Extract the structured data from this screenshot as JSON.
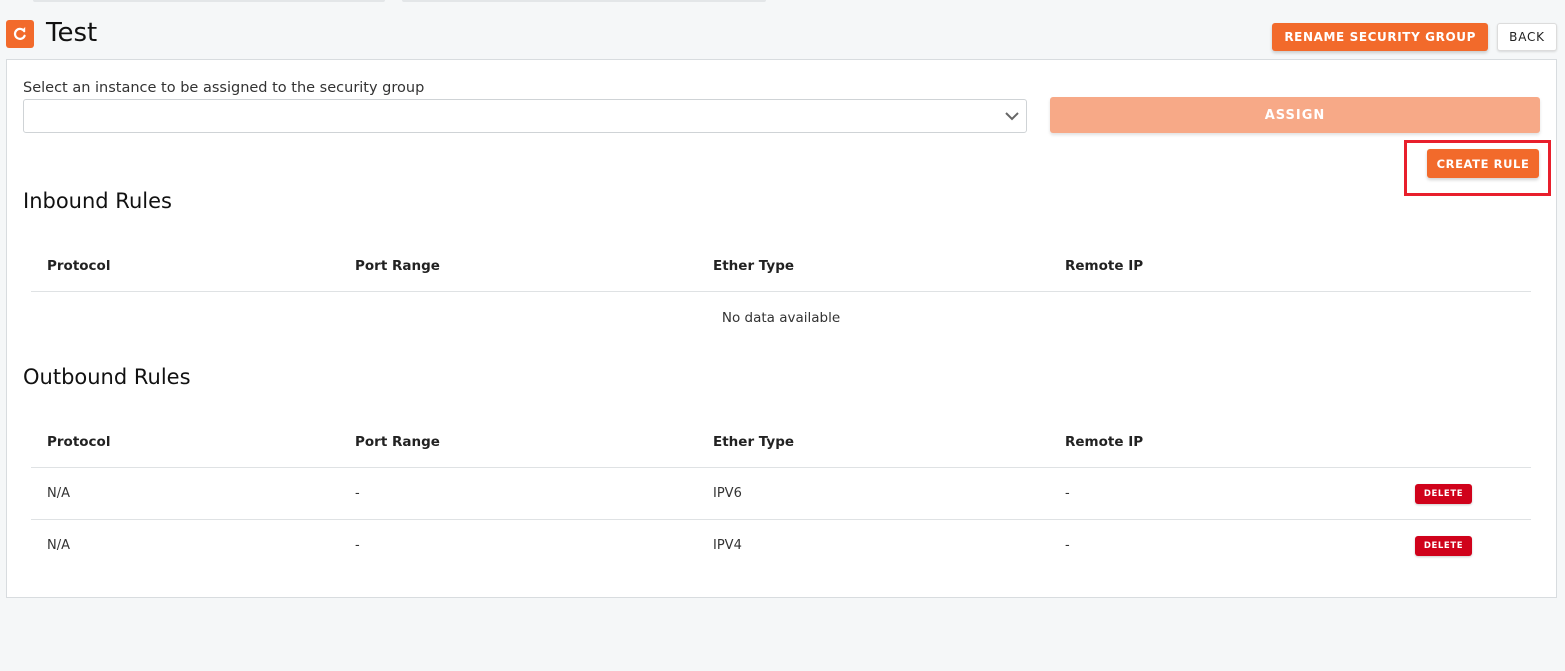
{
  "page": {
    "title": "Test",
    "accent_color": "#f26a2b",
    "refresh_icon": "refresh-icon"
  },
  "header": {
    "rename_label": "RENAME SECURITY GROUP",
    "back_label": "BACK"
  },
  "assign": {
    "select_label": "Select an instance to be assigned to the security group",
    "select_value": "",
    "button_label": "ASSIGN",
    "button_color": "#f7a987"
  },
  "create_rule": {
    "label": "CREATE RULE",
    "highlight_color": "#e81f2c"
  },
  "inbound": {
    "title": "Inbound Rules",
    "columns": [
      "Protocol",
      "Port Range",
      "Ether Type",
      "Remote IP"
    ],
    "empty_text": "No data available",
    "rows": []
  },
  "outbound": {
    "title": "Outbound Rules",
    "columns": [
      "Protocol",
      "Port Range",
      "Ether Type",
      "Remote IP"
    ],
    "delete_label": "DELETE",
    "delete_color": "#d0021b",
    "rows": [
      {
        "protocol": "N/A",
        "port_range": "-",
        "ether_type": "IPV6",
        "remote_ip": "-"
      },
      {
        "protocol": "N/A",
        "port_range": "-",
        "ether_type": "IPV4",
        "remote_ip": "-"
      }
    ]
  }
}
